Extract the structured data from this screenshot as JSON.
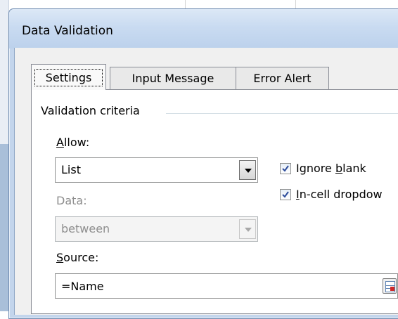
{
  "dialog": {
    "title": "Data Validation"
  },
  "tabs": [
    {
      "label": "Settings",
      "active": true
    },
    {
      "label": "Input Message",
      "active": false
    },
    {
      "label": "Error Alert",
      "active": false
    }
  ],
  "settings": {
    "group_title": "Validation criteria",
    "allow": {
      "label_pre": "",
      "label_mnemonic": "A",
      "label_post": "llow:",
      "value": "List"
    },
    "data": {
      "label": "Data:",
      "value": "between",
      "enabled": false
    },
    "ignore_blank": {
      "checked": true,
      "label_pre": "Ignore ",
      "label_mnemonic": "b",
      "label_post": "lank"
    },
    "in_cell_dropdown": {
      "checked": true,
      "label_pre": "",
      "label_mnemonic": "I",
      "label_post": "n-cell dropdow"
    },
    "source": {
      "label_pre": "",
      "label_mnemonic": "S",
      "label_post": "ource:",
      "value": "=Name"
    }
  },
  "colors": {
    "title_bar": "#c9dbf1",
    "client_bg": "#f0f0f0",
    "panel_bg": "#ffffff",
    "disabled_text": "#8e8e8e"
  },
  "icons": {
    "dropdown": "chevron-down-icon",
    "checkbox": "checkmark-icon",
    "range_selector": "collapse-dialog-icon"
  }
}
